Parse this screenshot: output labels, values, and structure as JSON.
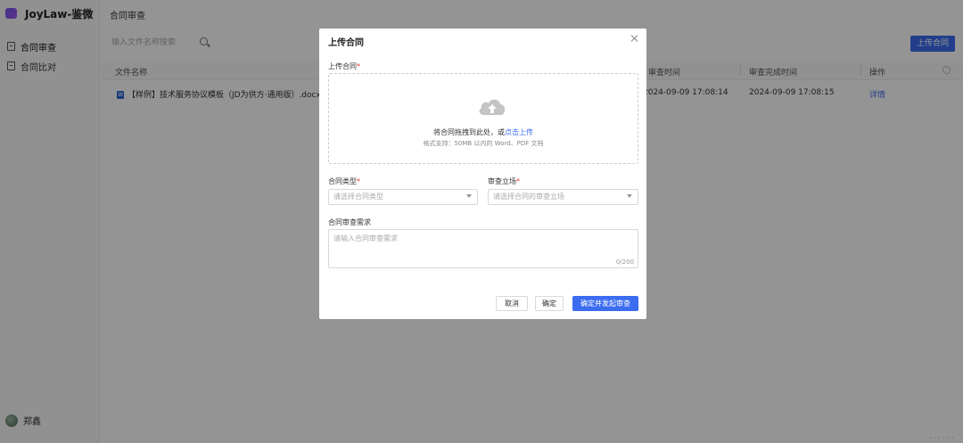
{
  "app": {
    "name": "JoyLaw-鉴微"
  },
  "sidebar": {
    "items": [
      {
        "label": "合同审查",
        "icon": "document-check-icon"
      },
      {
        "label": "合同比对",
        "icon": "compare-icon"
      }
    ],
    "user": {
      "name": "郑鑫"
    }
  },
  "main": {
    "page_title": "合同审查",
    "search_placeholder": "输入文件名称搜索",
    "upload_button": "上传合同",
    "table": {
      "columns": [
        "文件名称",
        "审查时间",
        "审查完成时间",
        "操作"
      ],
      "rows": [
        {
          "file_name": "【样例】技术服务协议模板（JD为供方·通用版）.docx",
          "review_time": "2024-09-09 17:08:14",
          "complete_time": "2024-09-09 17:08:15",
          "action": "详情"
        }
      ]
    }
  },
  "modal": {
    "title": "上传合同",
    "upload_label": "上传合同",
    "drop_text": "将合同拖拽到此处，或",
    "drop_link": "点击上传",
    "drop_hint": "格式支持：50MB 以内的 Word、PDF 文档",
    "contract_type_label": "合同类型",
    "contract_type_placeholder": "请选择合同类型",
    "stance_label": "审查立场",
    "stance_placeholder": "请选择合同的审查立场",
    "requirements_label": "合同审查需求",
    "requirements_placeholder": "请输入合同审查需求",
    "counter": "0/200",
    "cancel_button": "取消",
    "confirm_button": "确定",
    "primary_button": "确定并发起审查"
  },
  "colors": {
    "accent": "#3c6cf0",
    "required": "#e33333"
  }
}
